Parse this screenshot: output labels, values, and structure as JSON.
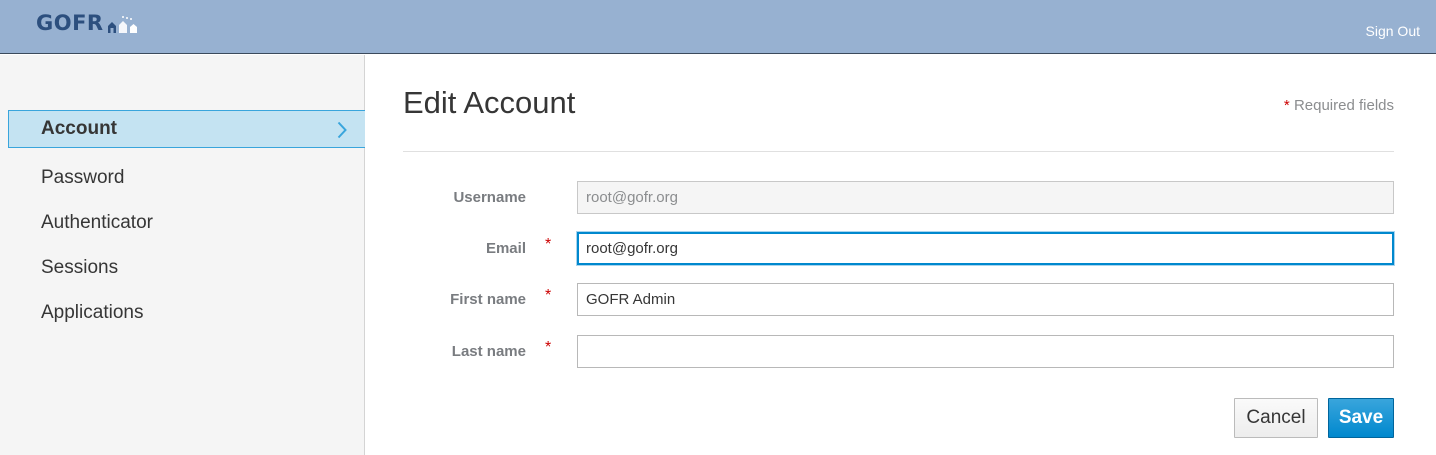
{
  "header": {
    "logo_text": "GOFR",
    "sign_out_label": "Sign Out"
  },
  "sidebar": {
    "items": [
      {
        "label": "Account",
        "active": true
      },
      {
        "label": "Password",
        "active": false
      },
      {
        "label": "Authenticator",
        "active": false
      },
      {
        "label": "Sessions",
        "active": false
      },
      {
        "label": "Applications",
        "active": false
      }
    ]
  },
  "main": {
    "title": "Edit Account",
    "required_star": "*",
    "required_note": "Required fields",
    "fields": {
      "username": {
        "label": "Username",
        "value": "root@gofr.org",
        "disabled": true
      },
      "email": {
        "label": "Email",
        "value": "root@gofr.org",
        "required": true
      },
      "first_name": {
        "label": "First name",
        "value": "GOFR Admin",
        "required": true
      },
      "last_name": {
        "label": "Last name",
        "value": "",
        "required": true
      }
    },
    "cancel_label": "Cancel",
    "save_label": "Save"
  },
  "colors": {
    "header_bg": "#97b1d1",
    "accent": "#0088ce",
    "required": "#cc0000",
    "active_nav_bg": "#c4e3f2"
  }
}
